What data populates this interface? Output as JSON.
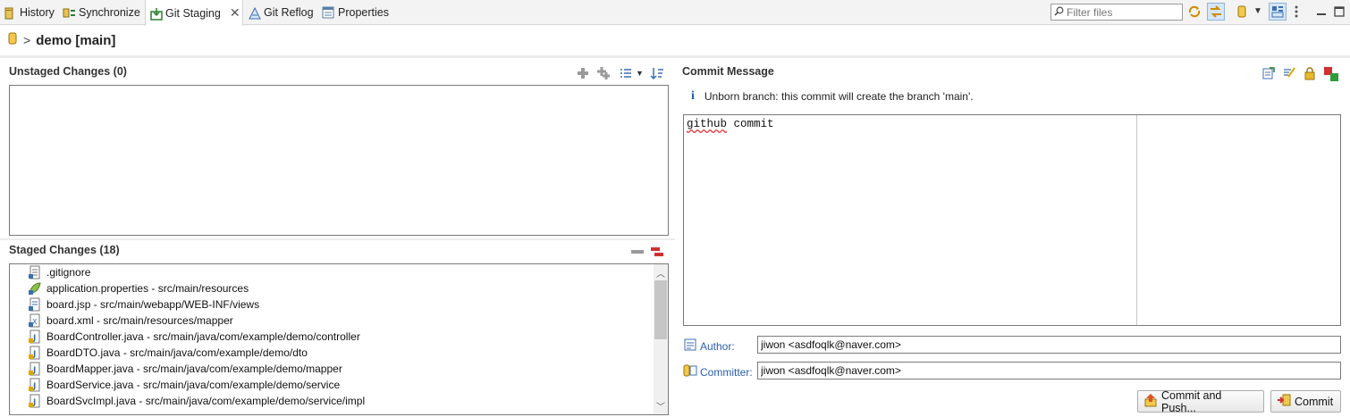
{
  "tabs": [
    {
      "label": "History",
      "icon": "history-icon"
    },
    {
      "label": "Synchronize",
      "icon": "synchronize-icon"
    },
    {
      "label": "Git Staging",
      "icon": "git-staging-icon",
      "active": true
    },
    {
      "label": "Git Reflog",
      "icon": "git-reflog-icon"
    },
    {
      "label": "Properties",
      "icon": "properties-icon"
    }
  ],
  "toolbar": {
    "filter_placeholder": "Filter files"
  },
  "breadcrumb": {
    "separator": ">",
    "repository": "demo [main]"
  },
  "unstaged": {
    "title": "Unstaged Changes (0)"
  },
  "staged": {
    "title": "Staged Changes (18)",
    "files": [
      {
        "name": ".gitignore",
        "icon": "text-file-icon"
      },
      {
        "name": "application.properties - src/main/resources",
        "icon": "properties-file-icon"
      },
      {
        "name": "board.jsp - src/main/webapp/WEB-INF/views",
        "icon": "jsp-file-icon"
      },
      {
        "name": "board.xml - src/main/resources/mapper",
        "icon": "xml-file-icon"
      },
      {
        "name": "BoardController.java - src/main/java/com/example/demo/controller",
        "icon": "java-file-icon"
      },
      {
        "name": "BoardDTO.java - src/main/java/com/example/demo/dto",
        "icon": "java-file-icon"
      },
      {
        "name": "BoardMapper.java - src/main/java/com/example/demo/mapper",
        "icon": "java-file-icon"
      },
      {
        "name": "BoardService.java - src/main/java/com/example/demo/service",
        "icon": "java-file-icon"
      },
      {
        "name": "BoardSvcImpl.java - src/main/java/com/example/demo/service/impl",
        "icon": "java-file-icon"
      }
    ]
  },
  "commit": {
    "title": "Commit Message",
    "info": "Unborn branch: this commit will create the branch 'main'.",
    "message_word1": "github",
    "message_word2": " commit",
    "author_label": "Author:",
    "author_value": "jiwon <asdfoqlk@naver.com>",
    "committer_label": "Committer:",
    "committer_value": "jiwon <asdfoqlk@naver.com>",
    "commit_push_label": "Commit and Push...",
    "commit_label": "Commit"
  },
  "colors": {
    "accent": "#2a5db0",
    "java_icon": "#3c6fb0",
    "repo_icon": "#e8b92c"
  }
}
